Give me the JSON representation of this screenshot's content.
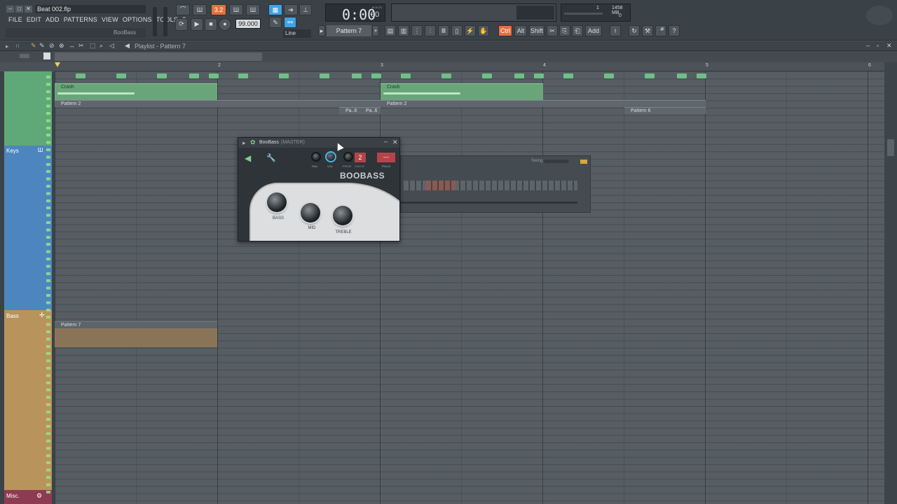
{
  "window": {
    "file_name": "Beat 002.flp"
  },
  "menu": [
    "FILE",
    "EDIT",
    "ADD",
    "PATTERNS",
    "VIEW",
    "OPTIONS",
    "TOOLS",
    "?"
  ],
  "hint_text": "BooBass",
  "tempo": "99.000",
  "time_display": {
    "main": "0:00",
    "sub": "00",
    "unit": "M:S:CS"
  },
  "snap_mode": "Line",
  "pattern_selector": "Pattern 7",
  "memory": {
    "top": "1",
    "mb": "1458 MB",
    "bottom": "0"
  },
  "toolbar_right": {
    "ctrl": "Ctrl",
    "alt": "Alt",
    "shift": "Shift",
    "add": "Add"
  },
  "playlist": {
    "title": "Playlist - Pattern 7"
  },
  "ruler": [
    "2",
    "3",
    "4",
    "5",
    "6"
  ],
  "tracks": {
    "keys": "Keys",
    "bass": "Bass",
    "misc": "Misc."
  },
  "clips": {
    "crash1": "Crash",
    "crash2": "Crash",
    "pattern2a": "Pattern 2",
    "pattern2b": "Pattern 2",
    "pa6a": "Pa..6",
    "pa6b": "Pa..6",
    "pattern6": "Pattern 6",
    "pattern7": "Pattern 7"
  },
  "plugin": {
    "title": "BooBass",
    "subtitle": "(MASTER)",
    "brand": "BOOBASS",
    "pan": "PAN",
    "vol": "VOL",
    "pitch": "PITCH",
    "range": "RANGE",
    "range_value": "2",
    "track": "TRACK",
    "track_value": "---",
    "bass": "BASS",
    "mid": "MID",
    "treble": "TREBLE"
  },
  "channel_rack": {
    "swing": "Swing"
  }
}
